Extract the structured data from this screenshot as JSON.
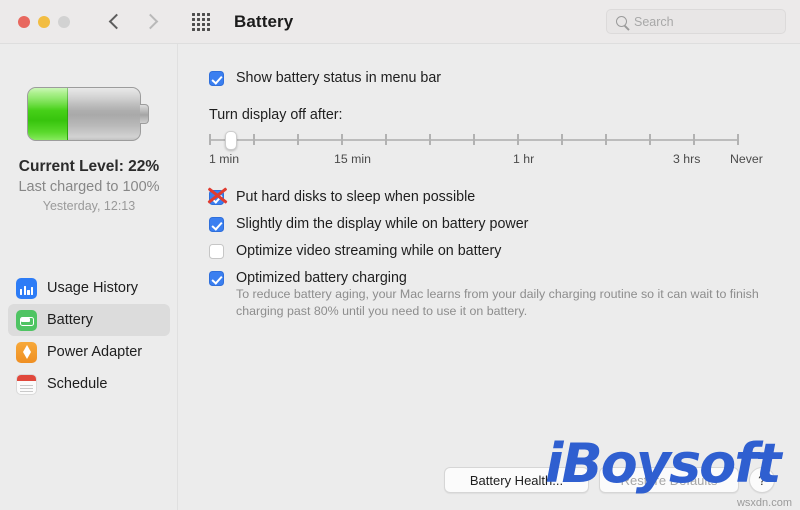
{
  "window": {
    "title": "Battery",
    "traffic_lights": [
      "close",
      "minimize",
      "zoom"
    ],
    "back_icon": "chevron-left-icon",
    "forward_icon": "chevron-right-icon",
    "grid_icon": "grid-dots-icon"
  },
  "search": {
    "placeholder": "Search",
    "value": "",
    "icon": "search-icon"
  },
  "sidebar": {
    "battery_icon": "battery-large-icon",
    "battery_fill_percent": 22,
    "current_level": "Current Level: 22%",
    "last_charged": "Last charged to 100%",
    "last_charged_when": "Yesterday, 12:13",
    "items": [
      {
        "label": "Usage History",
        "icon": "usage-history-icon",
        "selected": false
      },
      {
        "label": "Battery",
        "icon": "battery-icon",
        "selected": true
      },
      {
        "label": "Power Adapter",
        "icon": "power-adapter-icon",
        "selected": false
      },
      {
        "label": "Schedule",
        "icon": "schedule-calendar-icon",
        "selected": false
      }
    ]
  },
  "main": {
    "show_menu_bar": {
      "label": "Show battery status in menu bar",
      "checked": true
    },
    "slider": {
      "label": "Turn display off after:",
      "value_position_percent": 4,
      "tick_count": 13,
      "tick_labels": [
        {
          "text": "1 min",
          "percent": 0
        },
        {
          "text": "15 min",
          "percent": 25
        },
        {
          "text": "1 hr",
          "percent": 59
        },
        {
          "text": "3 hrs",
          "percent": 87
        },
        {
          "text": "Never",
          "percent": 99
        }
      ]
    },
    "options": [
      {
        "label": "Put hard disks to sleep when possible",
        "checked": true,
        "annotation": "red-x"
      },
      {
        "label": "Slightly dim the display while on battery power",
        "checked": true,
        "annotation": ""
      },
      {
        "label": "Optimize video streaming while on battery",
        "checked": false,
        "annotation": ""
      },
      {
        "label": "Optimized battery charging",
        "checked": true,
        "annotation": ""
      }
    ],
    "option_description": "To reduce battery aging, your Mac learns from your daily charging routine so it can wait to finish charging past 80% until you need to use it on battery."
  },
  "footer": {
    "battery_health_label": "Battery Health...",
    "restore_defaults_label": "Restore Defaults",
    "help_label": "?"
  },
  "watermark": {
    "brand": "iBoysoft",
    "site": "wsxdn.com"
  },
  "colors": {
    "accent_blue": "#3b7ff0",
    "battery_green": "#49d21a",
    "annotation_red": "#e03b30",
    "watermark_blue": "#2f5fd0",
    "window_bg": "#ececec"
  }
}
